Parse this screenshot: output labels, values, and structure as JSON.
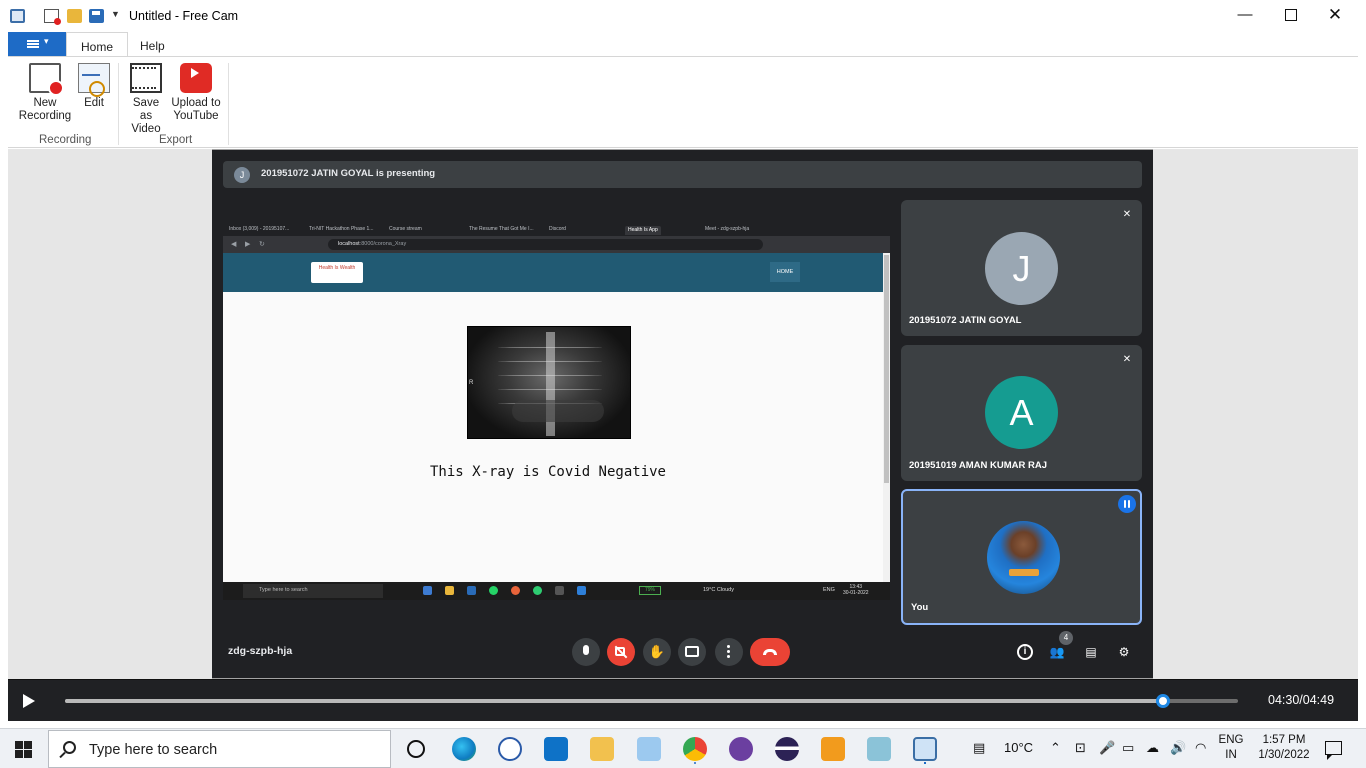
{
  "window": {
    "title": "Untitled - Free Cam",
    "min_glyph": "—",
    "close_glyph": "✕"
  },
  "ribbon": {
    "tabs": [
      "Home",
      "Help"
    ],
    "file_menu_arrow": "▾",
    "groups": {
      "recording": {
        "label": "Recording",
        "buttons": [
          {
            "label": "New Recording",
            "icon": "new-recording-icon"
          },
          {
            "label": "Edit",
            "icon": "edit-icon"
          }
        ]
      },
      "export": {
        "label": "Export",
        "buttons": [
          {
            "label": "Save as Video",
            "icon": "film-icon"
          },
          {
            "label": "Upload to YouTube",
            "icon": "youtube-icon"
          }
        ]
      }
    }
  },
  "meet": {
    "presenting_initial": "J",
    "presenting_text": "201951072 JATIN GOYAL is presenting",
    "meeting_code": "zdg-szpb-hja",
    "participant_count": "4",
    "participants": [
      {
        "initial": "J",
        "name": "201951072 JATIN GOYAL",
        "color": "#9aa7b3",
        "muted": true
      },
      {
        "initial": "A",
        "name": "201951019 AMAN KUMAR RAJ",
        "color": "#159c91",
        "muted": true
      },
      {
        "initial": "",
        "name": "You",
        "speaking": true
      }
    ],
    "mute_glyph": "✕",
    "controls": {
      "hand_glyph": "✋",
      "info_glyph": "i",
      "people_glyph": "👥",
      "chat_glyph": "▤",
      "activities_glyph": "⚙"
    }
  },
  "shared_screen": {
    "browser_tabs": [
      "Inbox (3,009) - 20195107...",
      "Tri-NIT Hackathon Phase 1...",
      "Course stream",
      "The Resume That Got Me I...",
      "Discord",
      "Health Is App",
      "Meet - zdg-szpb-hja"
    ],
    "url_prefix": "localhost",
    "url_path": ":8000/corona_Xray",
    "logo_text": "Health Is Wealth",
    "nav_home": "HOME",
    "xray_marker": "R",
    "result_text": "This X-ray is Covid Negative",
    "taskbar_search": "Type here to search",
    "battery": "79%",
    "weather": "19°C  Cloudy",
    "lang": "ENG",
    "time": "13:43",
    "date": "30-01-2022"
  },
  "player": {
    "current": "04:30",
    "total": "04:49",
    "time_display": "04:30/04:49",
    "progress_fraction": 0.936
  },
  "taskbar": {
    "search_placeholder": "Type here to search",
    "weather": "10°C",
    "lang_top": "ENG",
    "lang_bottom": "IN",
    "time": "1:57 PM",
    "date": "1/30/2022"
  },
  "colors": {
    "accent": "#1e6bc6",
    "meet_bg": "#202124",
    "end_call": "#ea4335",
    "seek_knob": "#1e88e5"
  }
}
